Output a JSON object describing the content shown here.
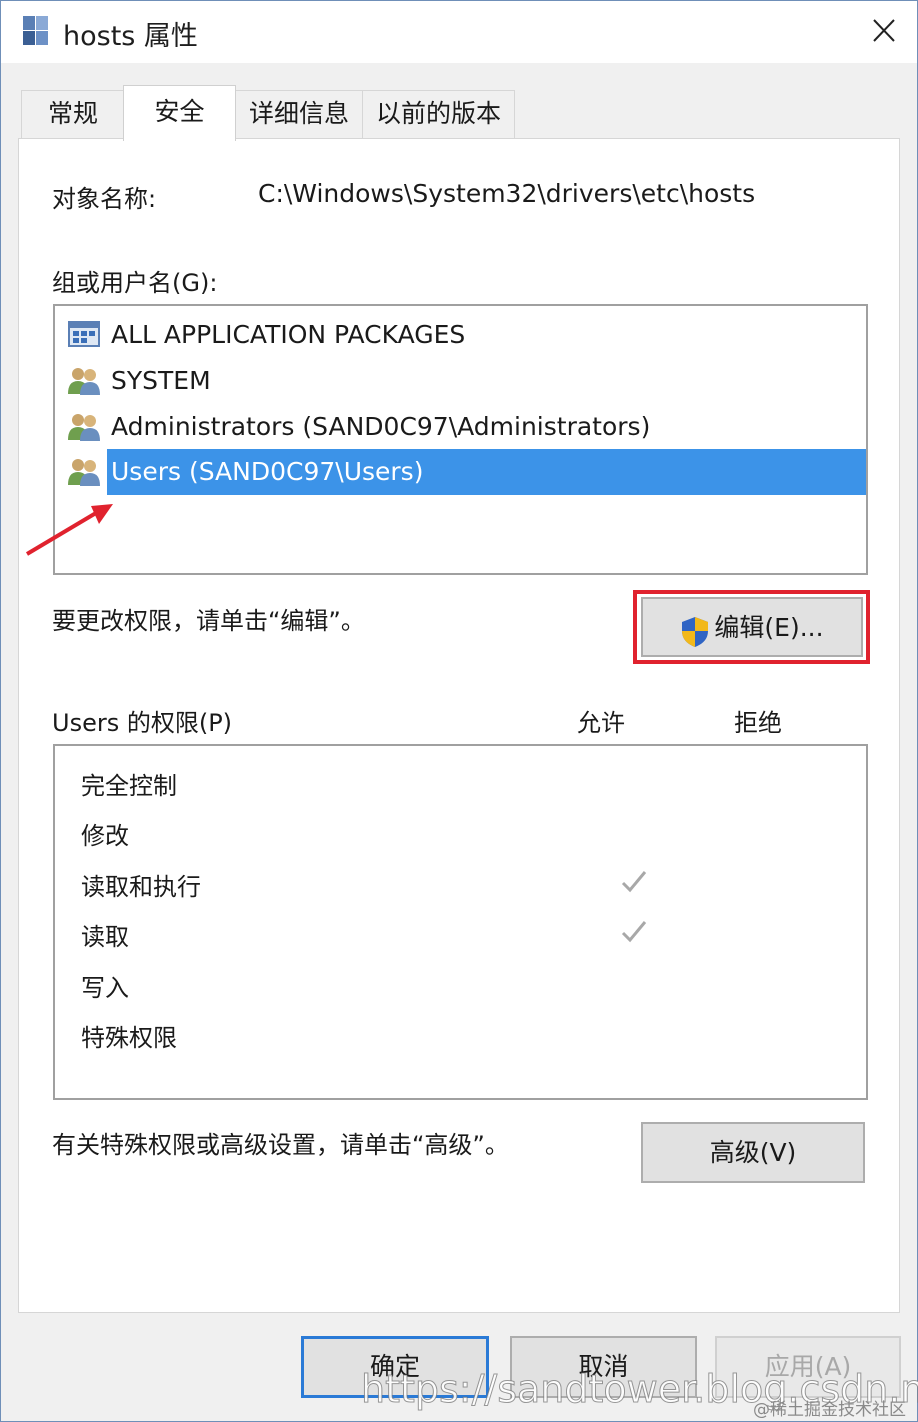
{
  "window": {
    "title": "hosts 属性"
  },
  "tabs": [
    {
      "label": "常规",
      "active": false
    },
    {
      "label": "安全",
      "active": true
    },
    {
      "label": "详细信息",
      "active": false
    },
    {
      "label": "以前的版本",
      "active": false
    }
  ],
  "security": {
    "object_name_label": "对象名称:",
    "object_name_value": "C:\\Windows\\System32\\drivers\\etc\\hosts",
    "groups_label": "组或用户名(G):",
    "groups": [
      {
        "name": "ALL APPLICATION PACKAGES",
        "icon": "app-packages-icon",
        "selected": false
      },
      {
        "name": "SYSTEM",
        "icon": "users-group-icon",
        "selected": false
      },
      {
        "name": "Administrators (SAND0C97\\Administrators)",
        "icon": "users-group-icon",
        "selected": false
      },
      {
        "name": "Users (SAND0C97\\Users)",
        "icon": "users-group-icon",
        "selected": true
      }
    ],
    "change_hint": "要更改权限，请单击“编辑”。",
    "edit_button": "编辑(E)...",
    "permissions_label": "Users 的权限(P)",
    "allow_header": "允许",
    "deny_header": "拒绝",
    "permissions": [
      {
        "name": "完全控制",
        "allow": false,
        "deny": false
      },
      {
        "name": "修改",
        "allow": false,
        "deny": false
      },
      {
        "name": "读取和执行",
        "allow": true,
        "deny": false
      },
      {
        "name": "读取",
        "allow": true,
        "deny": false
      },
      {
        "name": "写入",
        "allow": false,
        "deny": false
      },
      {
        "name": "特殊权限",
        "allow": false,
        "deny": false
      }
    ],
    "advanced_hint": "有关特殊权限或高级设置，请单击“高级”。",
    "advanced_button": "高级(V)"
  },
  "footer": {
    "ok_button": "确定",
    "cancel_button": "取消",
    "apply_button": "应用(A)"
  },
  "overlay": {
    "watermark": "https://sandtower.blog.csdn.net",
    "credit": "@稀土掘金技术社区"
  },
  "colors": {
    "selection": "#3c93e8",
    "highlight_box": "#e0222e",
    "arrow": "#e0222e",
    "default_button_border": "#2a7ad6"
  }
}
